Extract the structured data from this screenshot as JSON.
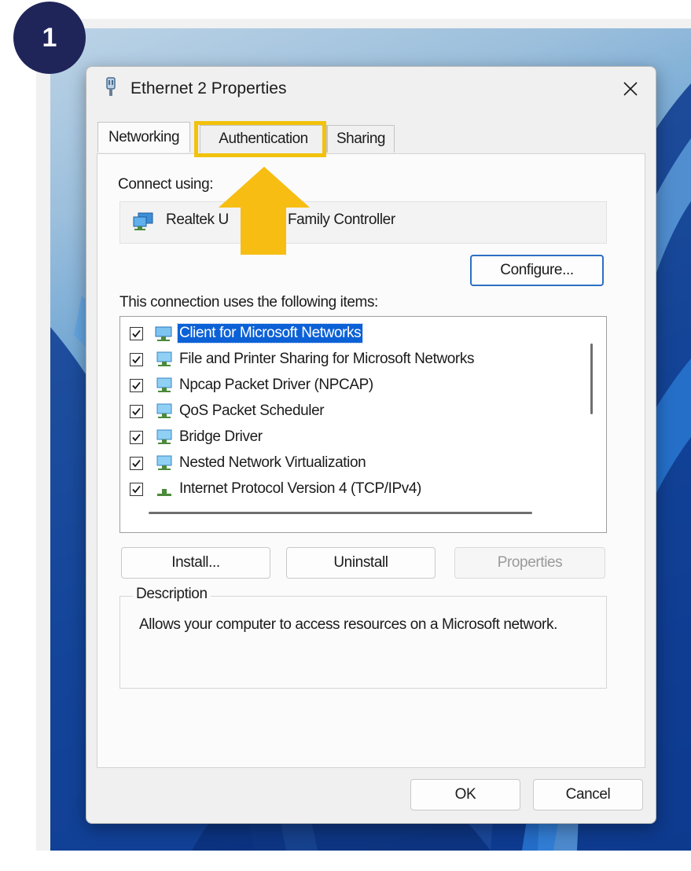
{
  "step_badge": "1",
  "dialog": {
    "title": "Ethernet 2 Properties",
    "tabs": [
      "Networking",
      "Authentication",
      "Sharing"
    ],
    "active_tab": "Networking",
    "highlighted_tab": "Authentication",
    "connect_using_label": "Connect using:",
    "adapter_name": "Realtek U",
    "adapter_name_tail": "E Family Controller",
    "configure_label": "Configure...",
    "items_label": "This connection uses the following items:",
    "items": [
      {
        "label": "Client for Microsoft Networks",
        "checked": true,
        "selected": true,
        "icon": "network-client-icon"
      },
      {
        "label": "File and Printer Sharing for Microsoft Networks",
        "checked": true,
        "selected": false,
        "icon": "network-service-icon"
      },
      {
        "label": "Npcap Packet Driver (NPCAP)",
        "checked": true,
        "selected": false,
        "icon": "network-service-icon"
      },
      {
        "label": "QoS Packet Scheduler",
        "checked": true,
        "selected": false,
        "icon": "network-service-icon"
      },
      {
        "label": "Bridge Driver",
        "checked": true,
        "selected": false,
        "icon": "network-service-icon"
      },
      {
        "label": "Nested Network Virtualization",
        "checked": true,
        "selected": false,
        "icon": "network-service-icon"
      },
      {
        "label": "Internet Protocol Version 4 (TCP/IPv4)",
        "checked": true,
        "selected": false,
        "icon": "protocol-icon"
      }
    ],
    "install_label": "Install...",
    "uninstall_label": "Uninstall",
    "properties_label": "Properties",
    "description_label": "Description",
    "description_text": "Allows your computer to access resources on a Microsoft network.",
    "ok_label": "OK",
    "cancel_label": "Cancel"
  },
  "colors": {
    "highlight": "#f2c20c",
    "badge": "#1f2559",
    "selection": "#0c61d6",
    "arrow": "#f7bd12"
  }
}
